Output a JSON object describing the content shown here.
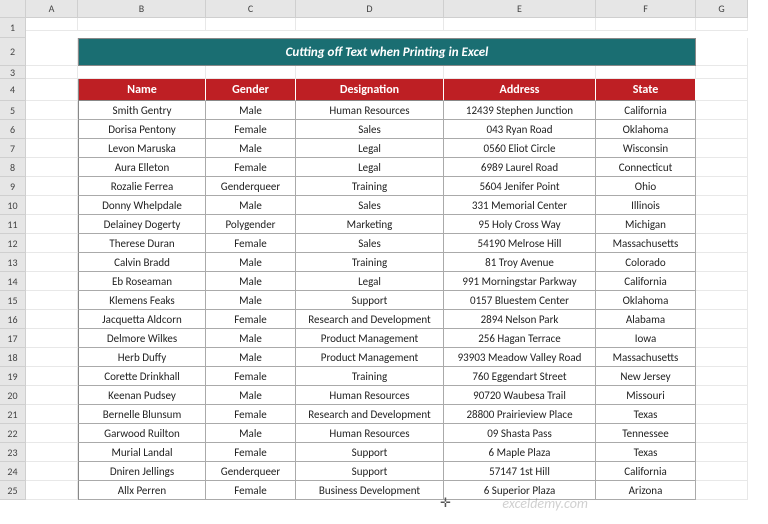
{
  "columns": [
    "A",
    "B",
    "C",
    "D",
    "E",
    "F",
    "G"
  ],
  "title": "Cutting off Text when Printing in Excel",
  "headers": [
    "Name",
    "Gender",
    "Designation",
    "Address",
    "State"
  ],
  "rows": [
    [
      "Smith Gentry",
      "Male",
      "Human Resources",
      "12439 Stephen Junction",
      "California"
    ],
    [
      "Dorisa Pentony",
      "Female",
      "Sales",
      "043 Ryan Road",
      "Oklahoma"
    ],
    [
      "Levon Maruska",
      "Male",
      "Legal",
      "0560 Eliot Circle",
      "Wisconsin"
    ],
    [
      "Aura Elleton",
      "Female",
      "Legal",
      "6989 Laurel Road",
      "Connecticut"
    ],
    [
      "Rozalie Ferrea",
      "Genderqueer",
      "Training",
      "5604 Jenifer Point",
      "Ohio"
    ],
    [
      "Donny Whelpdale",
      "Male",
      "Sales",
      "331 Memorial Center",
      "Illinois"
    ],
    [
      "Delainey Dogerty",
      "Polygender",
      "Marketing",
      "95 Holy Cross Way",
      "Michigan"
    ],
    [
      "Therese Duran",
      "Female",
      "Sales",
      "54190 Melrose Hill",
      "Massachusetts"
    ],
    [
      "Calvin Bradd",
      "Male",
      "Training",
      "81 Troy Avenue",
      "Colorado"
    ],
    [
      "Eb Roseaman",
      "Male",
      "Legal",
      "991 Morningstar Parkway",
      "California"
    ],
    [
      "Klemens Feaks",
      "Male",
      "Support",
      "0157 Bluestem Center",
      "Oklahoma"
    ],
    [
      "Jacquetta Aldcorn",
      "Female",
      "Research and Development",
      "2894 Nelson Park",
      "Alabama"
    ],
    [
      "Delmore Wilkes",
      "Male",
      "Product Management",
      "256 Hagan Terrace",
      "Iowa"
    ],
    [
      "Herb Duffy",
      "Male",
      "Product Management",
      "93903 Meadow Valley Road",
      "Massachusetts"
    ],
    [
      "Corette Drinkhall",
      "Female",
      "Training",
      "760 Eggendart Street",
      "New Jersey"
    ],
    [
      "Keenan Pudsey",
      "Male",
      "Human Resources",
      "90720 Waubesa Trail",
      "Missouri"
    ],
    [
      "Bernelle Blunsum",
      "Female",
      "Research and Development",
      "28800 Prairieview Place",
      "Texas"
    ],
    [
      "Garwood Ruilton",
      "Male",
      "Human Resources",
      "09 Shasta Pass",
      "Tennessee"
    ],
    [
      "Murial Landal",
      "Female",
      "Support",
      "6 Maple Plaza",
      "Texas"
    ],
    [
      "Dniren Jellings",
      "Genderqueer",
      "Support",
      "57147 1st Hill",
      "California"
    ],
    [
      "Allx Perren",
      "Female",
      "Business Development",
      "6 Superior Plaza",
      "Arizona"
    ]
  ],
  "watermark": "exceldemy.com"
}
